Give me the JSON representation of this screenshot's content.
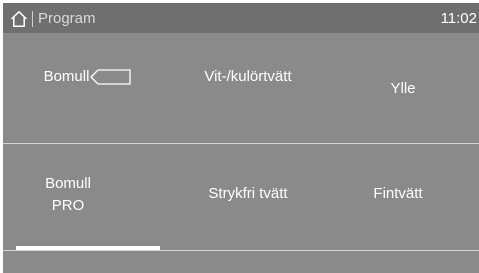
{
  "header": {
    "breadcrumb": "Program",
    "time": "11:02"
  },
  "programs": {
    "row1": [
      {
        "label": "Bomull",
        "has_door_icon": true
      },
      {
        "label": "Vit-/kulörtvätt"
      },
      {
        "label": "Ylle"
      }
    ],
    "row2": [
      {
        "line1": "Bomull",
        "line2": "PRO"
      },
      {
        "label": "Strykfri tvätt"
      },
      {
        "label": "Fintvätt"
      }
    ]
  },
  "icons": {
    "home": "home-icon",
    "door": "door-icon"
  },
  "colors": {
    "background": "#8a8a8a",
    "status_bar": "#6f6f6f",
    "text": "#ffffff",
    "divider": "#d4d4d4",
    "page_indicator": "#ffffff"
  },
  "pagination": {
    "current_page": 1
  }
}
